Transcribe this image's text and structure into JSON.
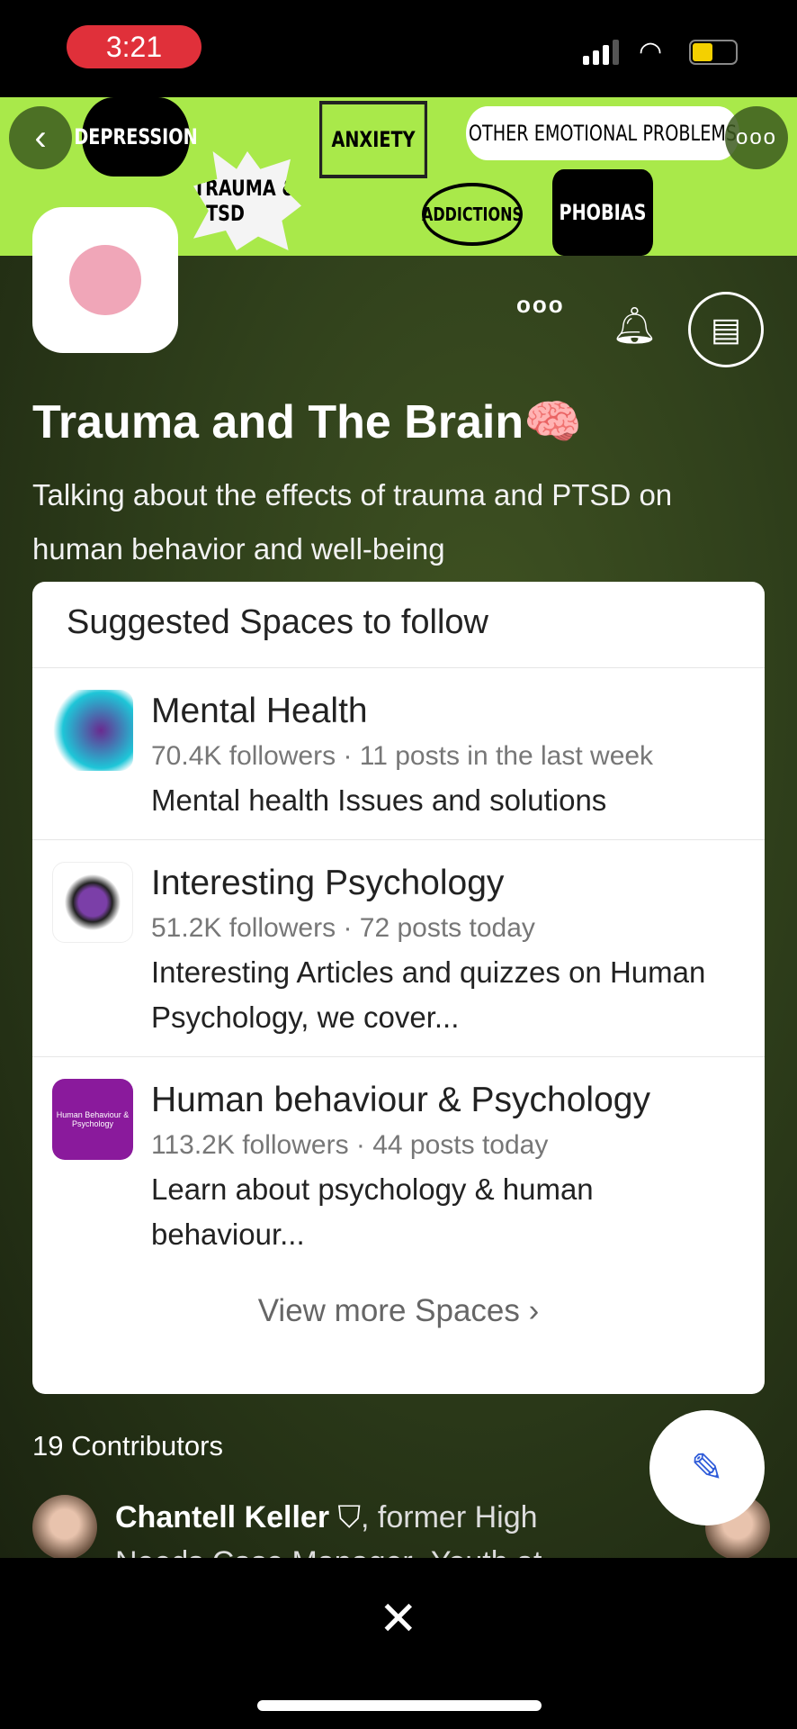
{
  "status_bar": {
    "time": "3:21",
    "icons": [
      "signal-icon",
      "wifi-icon",
      "battery-icon"
    ],
    "battery_color": "#f4d000"
  },
  "banner": {
    "words": [
      "DEPRESSION",
      "TRAUMA & PTSD",
      "ANXIETY",
      "OTHER EMOTIONAL PROBLEMS",
      "ADDICTIONS",
      "PHOBIAS"
    ],
    "bg_color": "#a9e94a"
  },
  "space": {
    "title": "Trauma and The Brain🧠",
    "description": "Talking about the effects of trauma and PTSD on human behavior and well-being"
  },
  "suggested": {
    "header": "Suggested Spaces to follow",
    "items": [
      {
        "name": "Mental Health",
        "meta": "70.4K followers · 11 posts in the last week",
        "desc": "Mental health Issues and solutions"
      },
      {
        "name": "Interesting Psychology",
        "meta": "51.2K followers · 72 posts today",
        "desc": "Interesting Articles and quizzes on Human Psychology, we cover..."
      },
      {
        "name": "Human behaviour & Psychology",
        "meta": "113.2K followers · 44 posts today",
        "desc": "Learn about psychology & human behaviour...",
        "icon_text": "Human Behaviour & Psychology"
      }
    ],
    "view_more": "View more Spaces ›"
  },
  "contributors": {
    "count_label": "19 Contributors",
    "first": {
      "name": "Chantell Keller",
      "credential": ", former High",
      "line2": "Needs Case Manager- Youth at"
    }
  },
  "accent": "#2e5bd9"
}
